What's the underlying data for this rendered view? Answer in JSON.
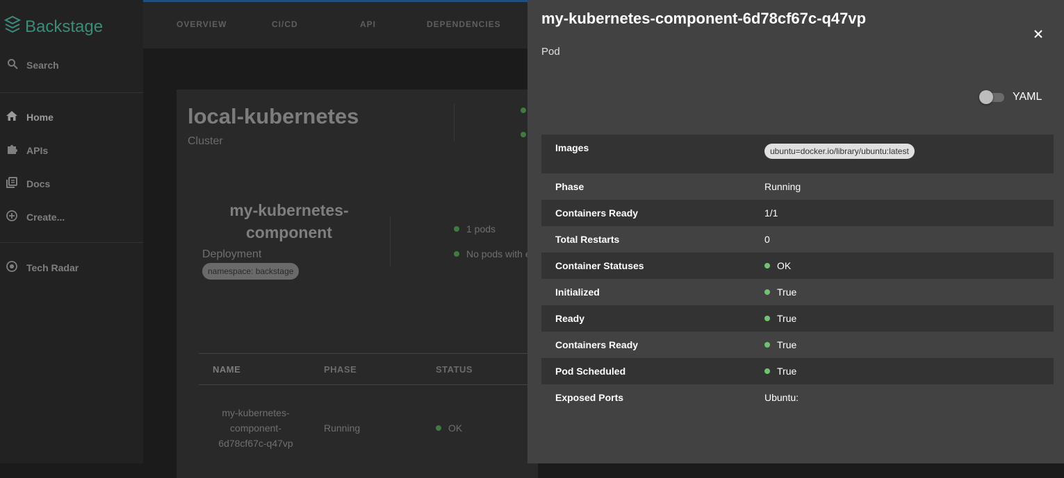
{
  "sidebar": {
    "brand": "Backstage",
    "search_label": "Search",
    "items": [
      {
        "label": "Home"
      },
      {
        "label": "APIs"
      },
      {
        "label": "Docs"
      },
      {
        "label": "Create..."
      },
      {
        "label": "Tech Radar"
      }
    ]
  },
  "tabs": [
    "OVERVIEW",
    "CI/CD",
    "API",
    "DEPENDENCIES"
  ],
  "cluster": {
    "title": "local-kubernetes",
    "subtitle": "Cluster"
  },
  "deployment": {
    "name": "my-kubernetes-component",
    "kind": "Deployment",
    "namespace_chip": "namespace: backstage",
    "stats": [
      "1 pods",
      "No pods with e"
    ]
  },
  "pods_table": {
    "headers": [
      "NAME",
      "PHASE",
      "STATUS"
    ],
    "rows": [
      {
        "name": "my-kubernetes-component-6d78cf67c-q47vp",
        "phase": "Running",
        "status": "OK"
      }
    ]
  },
  "drawer": {
    "title": "my-kubernetes-component-6d78cf67c-q47vp",
    "subtitle": "Pod",
    "yaml_toggle_label": "YAML",
    "yaml_toggle_on": false,
    "fields": [
      {
        "key": "Images",
        "value": "ubuntu=docker.io/library/ubuntu:latest",
        "type": "chip"
      },
      {
        "key": "Phase",
        "value": "Running",
        "type": "text"
      },
      {
        "key": "Containers Ready",
        "value": "1/1",
        "type": "text"
      },
      {
        "key": "Total Restarts",
        "value": "0",
        "type": "text"
      },
      {
        "key": "Container Statuses",
        "value": "OK",
        "type": "status"
      },
      {
        "key": "Initialized",
        "value": "True",
        "type": "status"
      },
      {
        "key": "Ready",
        "value": "True",
        "type": "status"
      },
      {
        "key": "Containers Ready",
        "value": "True",
        "type": "status"
      },
      {
        "key": "Pod Scheduled",
        "value": "True",
        "type": "status"
      },
      {
        "key": "Exposed Ports",
        "value": "Ubuntu:",
        "type": "text"
      }
    ]
  },
  "colors": {
    "brand": "#3d8b7a",
    "status_ok": "#71c374",
    "drawer_bg": "#424242"
  }
}
